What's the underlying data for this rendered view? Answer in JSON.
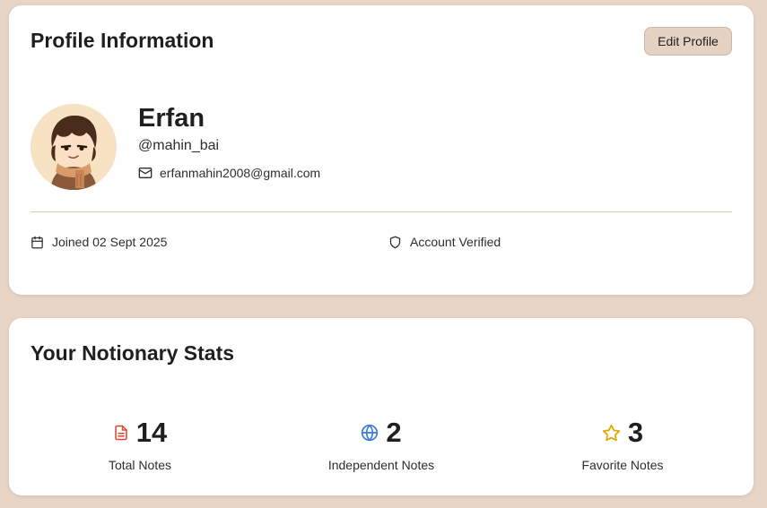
{
  "profile": {
    "title": "Profile Information",
    "edit_label": "Edit Profile",
    "name": "Erfan",
    "handle": "@mahin_bai",
    "email": "erfanmahin2008@gmail.com",
    "joined": "Joined 02 Sept 2025",
    "verified": "Account Verified"
  },
  "stats": {
    "title": "Your Notionary Stats",
    "items": [
      {
        "value": "14",
        "label": "Total Notes",
        "icon": "document-icon",
        "color": "#d9472b"
      },
      {
        "value": "2",
        "label": "Independent Notes",
        "icon": "globe-icon",
        "color": "#3b7dd8"
      },
      {
        "value": "3",
        "label": "Favorite Notes",
        "icon": "star-icon",
        "color": "#e0a800"
      }
    ]
  },
  "colors": {
    "background": "#e8d5c6",
    "card": "#ffffff",
    "button": "#e6d2c3"
  }
}
